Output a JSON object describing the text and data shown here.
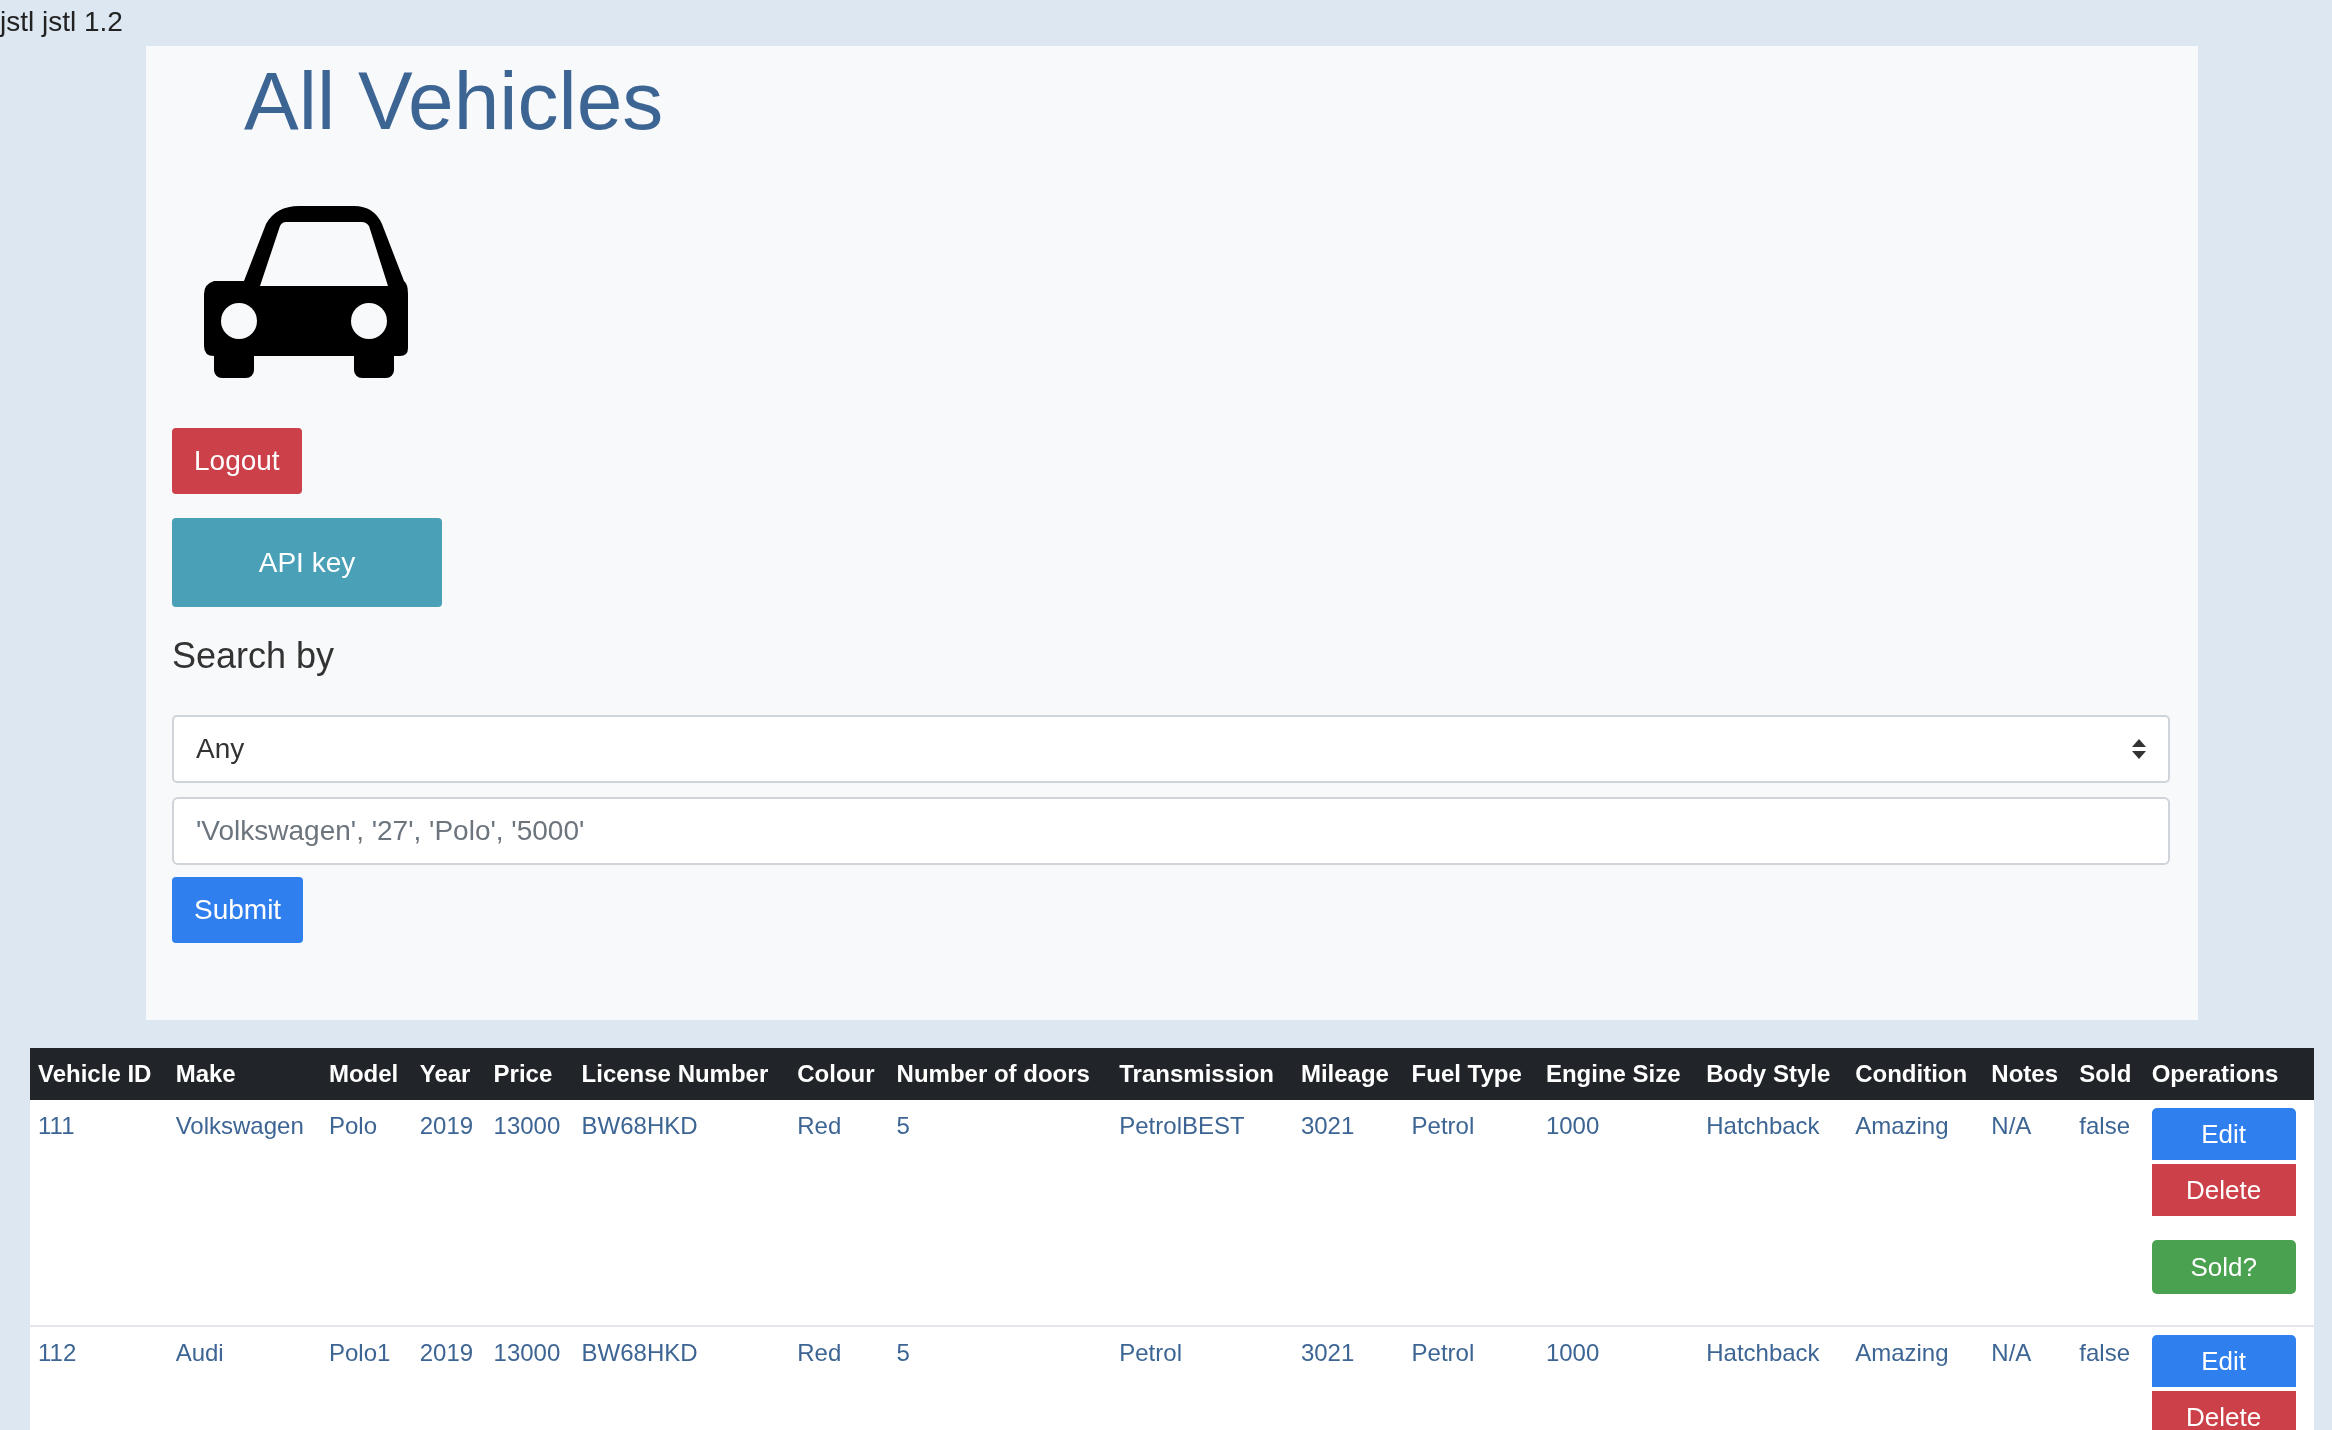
{
  "header_text": "jstl jstl 1.2",
  "title": "All Vehicles",
  "buttons": [
    {
      "label": "Logout",
      "kind": "danger"
    },
    {
      "label": "API key",
      "kind": "info"
    }
  ],
  "search": {
    "heading": "Search by",
    "select_value": "Any",
    "placeholder": "'Volkswagen', '27', 'Polo', '5000'",
    "submit": "Submit"
  },
  "table": {
    "columns": [
      "Vehicle ID",
      "Make",
      "Model",
      "Year",
      "Price",
      "License Number",
      "Colour",
      "Number of doors",
      "Transmission",
      "Mileage",
      "Fuel Type",
      "Engine Size",
      "Body Style",
      "Condition",
      "Notes",
      "Sold",
      "Operations"
    ],
    "rows": [
      {
        "cells": [
          "111",
          "Volkswagen",
          "Polo",
          "2019",
          "13000",
          "BW68HKD",
          "Red",
          "5",
          "PetrolBEST",
          "3021",
          "Petrol",
          "1000",
          "Hatchback",
          "Amazing",
          "N/A",
          "false"
        ],
        "operations": [
          {
            "label": "Edit",
            "kind": "edit"
          },
          {
            "label": "Delete",
            "kind": "delete"
          },
          {
            "label": "Sold?",
            "kind": "sold"
          }
        ]
      },
      {
        "cells": [
          "112",
          "Audi",
          "Polo1",
          "2019",
          "13000",
          "BW68HKD",
          "Red",
          "5",
          "Petrol",
          "3021",
          "Petrol",
          "1000",
          "Hatchback",
          "Amazing",
          "N/A",
          "false"
        ],
        "operations": [
          {
            "label": "Edit",
            "kind": "edit"
          },
          {
            "label": "Delete",
            "kind": "delete"
          }
        ]
      }
    ]
  }
}
